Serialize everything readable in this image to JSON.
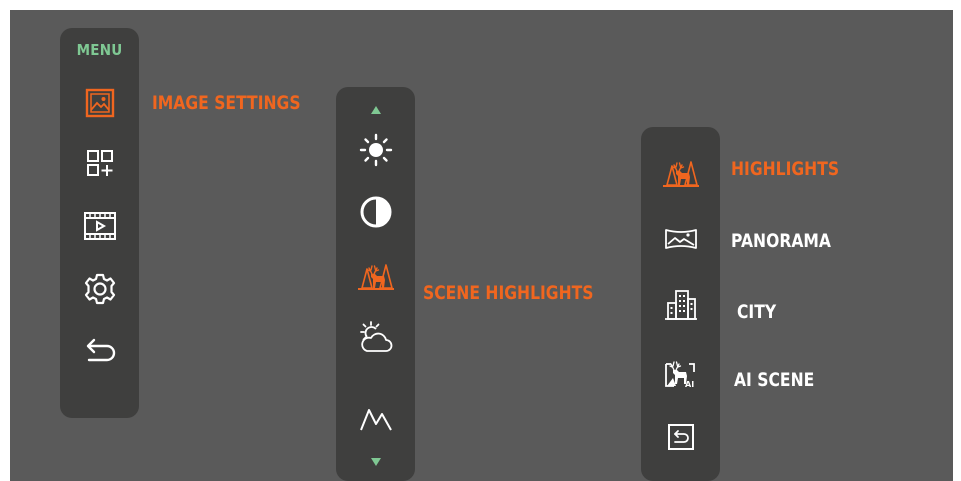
{
  "colors": {
    "screen_bg": "#5a5a5a",
    "panel_bg": "#3f3f3e",
    "accent_orange": "#f0661f",
    "menu_title_green": "#7fc893",
    "icon_white": "#ffffff"
  },
  "menu": {
    "title": "MENU",
    "items": [
      {
        "icon": "image-settings-icon",
        "selected": true
      },
      {
        "icon": "grid-add-icon",
        "selected": false
      },
      {
        "icon": "video-film-icon",
        "selected": false
      },
      {
        "icon": "gear-icon",
        "selected": false
      },
      {
        "icon": "return-icon",
        "selected": false
      }
    ],
    "selected_label": "IMAGE SETTINGS"
  },
  "image_settings": {
    "items": [
      {
        "icon": "chevron-up-icon"
      },
      {
        "icon": "brightness-icon"
      },
      {
        "icon": "contrast-icon"
      },
      {
        "icon": "scene-highlights-icon",
        "selected": true
      },
      {
        "icon": "weather-sun-cloud-icon"
      },
      {
        "icon": "mountain-icon"
      },
      {
        "icon": "chevron-down-icon"
      }
    ],
    "selected_label": "SCENE  HIGHLIGHTS"
  },
  "scene_highlights": {
    "items": [
      {
        "icon": "highlights-deer-icon",
        "label": "HIGHLIGHTS",
        "selected": true
      },
      {
        "icon": "panorama-icon",
        "label": "PANORAMA",
        "selected": false
      },
      {
        "icon": "city-icon",
        "label": "CITY",
        "selected": false
      },
      {
        "icon": "ai-scene-icon",
        "label": "AI SCENE",
        "selected": false
      },
      {
        "icon": "back-icon",
        "selected": false
      }
    ]
  }
}
